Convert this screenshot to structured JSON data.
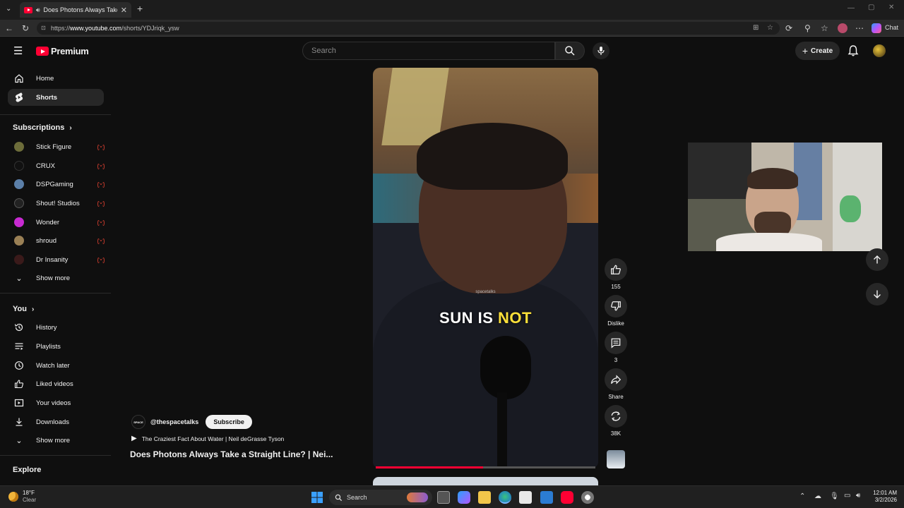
{
  "browser": {
    "tab_title": "Does Photons Always Take a St",
    "url_prefix": "https://",
    "url_host": "www.youtube.com",
    "url_path": "/shorts/YDJriqk_ysw",
    "chat_label": "Chat"
  },
  "header": {
    "logo_text": "Premium",
    "search_placeholder": "Search",
    "create_label": "Create"
  },
  "sidebar": {
    "main": [
      {
        "label": "Home",
        "icon": "home-icon"
      },
      {
        "label": "Shorts",
        "icon": "shorts-icon",
        "active": true
      }
    ],
    "subscriptions_title": "Subscriptions",
    "subscriptions": [
      {
        "label": "Stick Figure",
        "color": "#6d6d3a"
      },
      {
        "label": "CRUX",
        "color": "#111111"
      },
      {
        "label": "DSPGaming",
        "color": "#5b7fa8"
      },
      {
        "label": "Shout! Studios",
        "color": "#222222"
      },
      {
        "label": "Wonder",
        "color": "#c72ad1"
      },
      {
        "label": "shroud",
        "color": "#9a8055"
      },
      {
        "label": "Dr Insanity",
        "color": "#3a1a1a"
      }
    ],
    "show_more_1": "Show more",
    "you_title": "You",
    "you_items": [
      {
        "label": "History",
        "icon": "history-icon"
      },
      {
        "label": "Playlists",
        "icon": "playlists-icon"
      },
      {
        "label": "Watch later",
        "icon": "clock-icon"
      },
      {
        "label": "Liked videos",
        "icon": "thumbs-up-icon"
      },
      {
        "label": "Your videos",
        "icon": "video-icon"
      },
      {
        "label": "Downloads",
        "icon": "download-icon"
      }
    ],
    "show_more_2": "Show more",
    "explore_title": "Explore"
  },
  "video": {
    "caption_white": "SUN IS",
    "caption_yellow": "NOT",
    "watermark": "spacetalks",
    "progress_fraction": 0.49
  },
  "actions": {
    "likes": "155",
    "dislike_label": "Dislike",
    "comments": "3",
    "share_label": "Share",
    "remix_count": "38K"
  },
  "info": {
    "channel": "@thespacetalks",
    "channel_avatar_text": "SPACE",
    "subscribe_label": "Subscribe",
    "playlist_title": "The Craziest Fact About Water | Neil deGrasse Tyson",
    "video_title": "Does Photons Always Take a Straight Line? | Nei..."
  },
  "taskbar": {
    "weather_temp": "18°F",
    "weather_desc": "Clear",
    "search_label": "Search",
    "time": "12:01 AM",
    "date": "3/2/2026"
  },
  "colors": {
    "accent_red": "#ff0033",
    "caption_yellow": "#fbe03a",
    "bg": "#0f0f0f"
  }
}
